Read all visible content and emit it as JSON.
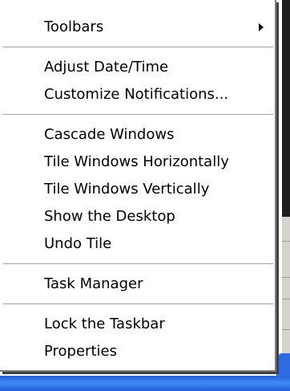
{
  "context_menu": {
    "toolbars": {
      "label": "Toolbars",
      "has_submenu": true,
      "arrow_icon": "submenu-arrow-icon"
    },
    "adjust_date_time": {
      "label": "Adjust Date/Time"
    },
    "customize_notifications": {
      "label": "Customize Notifications..."
    },
    "cascade_windows": {
      "label": "Cascade Windows"
    },
    "tile_horizontally": {
      "label": "Tile Windows Horizontally"
    },
    "tile_vertically": {
      "label": "Tile Windows Vertically"
    },
    "show_desktop": {
      "label": "Show the Desktop"
    },
    "undo_tile": {
      "label": "Undo Tile"
    },
    "task_manager": {
      "label": "Task Manager"
    },
    "lock_taskbar": {
      "label": "Lock the Taskbar"
    },
    "properties": {
      "label": "Properties"
    }
  },
  "colors": {
    "menu_background": "#ffffff",
    "menu_text": "#000000",
    "separator": "#a0a0a0",
    "taskbar_blue": "#245edb"
  }
}
